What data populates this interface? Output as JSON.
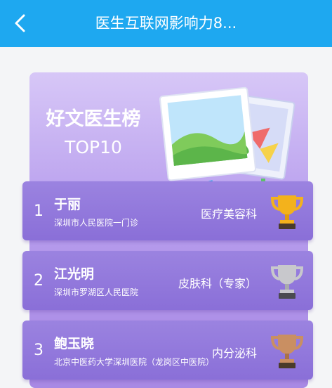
{
  "header": {
    "back_icon": "chevron-left-icon",
    "title": "医生互联网影响力8..."
  },
  "hero": {
    "title": "好文医生榜",
    "subtitle": "TOP10",
    "illustration_icon": "photo-stack-icon"
  },
  "ranking": [
    {
      "rank": "1",
      "name": "于丽",
      "hospital": "深圳市人民医院一门诊",
      "department": "医疗美容科",
      "trophy": "gold-trophy-icon"
    },
    {
      "rank": "2",
      "name": "江光明",
      "hospital": "深圳市罗湖区人民医院",
      "department": "皮肤科（专家）",
      "trophy": "silver-trophy-icon"
    },
    {
      "rank": "3",
      "name": "鲍玉晓",
      "hospital": "北京中医药大学深圳医院（龙岗区中医院）",
      "department": "内分泌科",
      "trophy": "bronze-trophy-icon"
    }
  ],
  "colors": {
    "topbar": "#1ea8f0",
    "card_top": "#d7c7f7",
    "card_bottom": "#a889e4",
    "row": "#8a6fd8",
    "gold": "#f3b21c",
    "silver": "#c8c8cc",
    "bronze": "#c98f62"
  }
}
